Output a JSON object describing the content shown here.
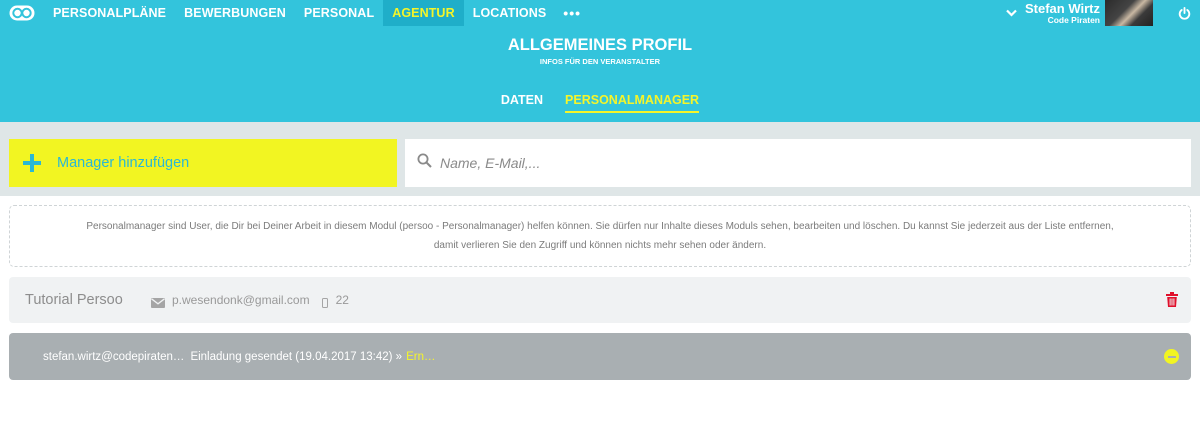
{
  "nav": {
    "items": [
      {
        "label": "PERSONALPLÄNE"
      },
      {
        "label": "BEWERBUNGEN"
      },
      {
        "label": "PERSONAL"
      },
      {
        "label": "AGENTUR"
      },
      {
        "label": "LOCATIONS"
      }
    ],
    "more_label": "•••",
    "active_index": 3
  },
  "user": {
    "name": "Stefan Wirtz",
    "organization": "Code Piraten"
  },
  "header": {
    "title": "ALLGEMEINES PROFIL",
    "subtitle": "INFOS FÜR DEN VERANSTALTER",
    "tabs": [
      {
        "label": "DATEN"
      },
      {
        "label": "PERSONALMANAGER"
      }
    ],
    "active_tab": 1
  },
  "toolbar": {
    "add_label": "Manager hinzufügen",
    "search_placeholder": "Name, E-Mail,..."
  },
  "info": {
    "line1": "Personalmanager sind User, die Dir bei Deiner Arbeit in diesem Modul (persoo - Personalmanager) helfen können. Sie dürfen nur Inhalte dieses Moduls sehen, bearbeiten und löschen. Du kannst Sie jederzeit aus der Liste entfernen,",
    "line2": "damit verlieren Sie den Zugriff und können nichts mehr sehen oder ändern."
  },
  "managers": [
    {
      "name": "Tutorial Persoo",
      "email": "p.wesendonk@gmail.com",
      "phone": "22"
    }
  ],
  "invites": [
    {
      "email": "stefan.wirtz@codepiraten…",
      "status": "Einladung gesendet (19.04.2017 13:42) »",
      "link": "Ern…"
    }
  ],
  "colors": {
    "brand": "#33c4dc",
    "accent": "#f2f522",
    "danger": "#e0102b",
    "invite_bg": "#a9afb2"
  }
}
